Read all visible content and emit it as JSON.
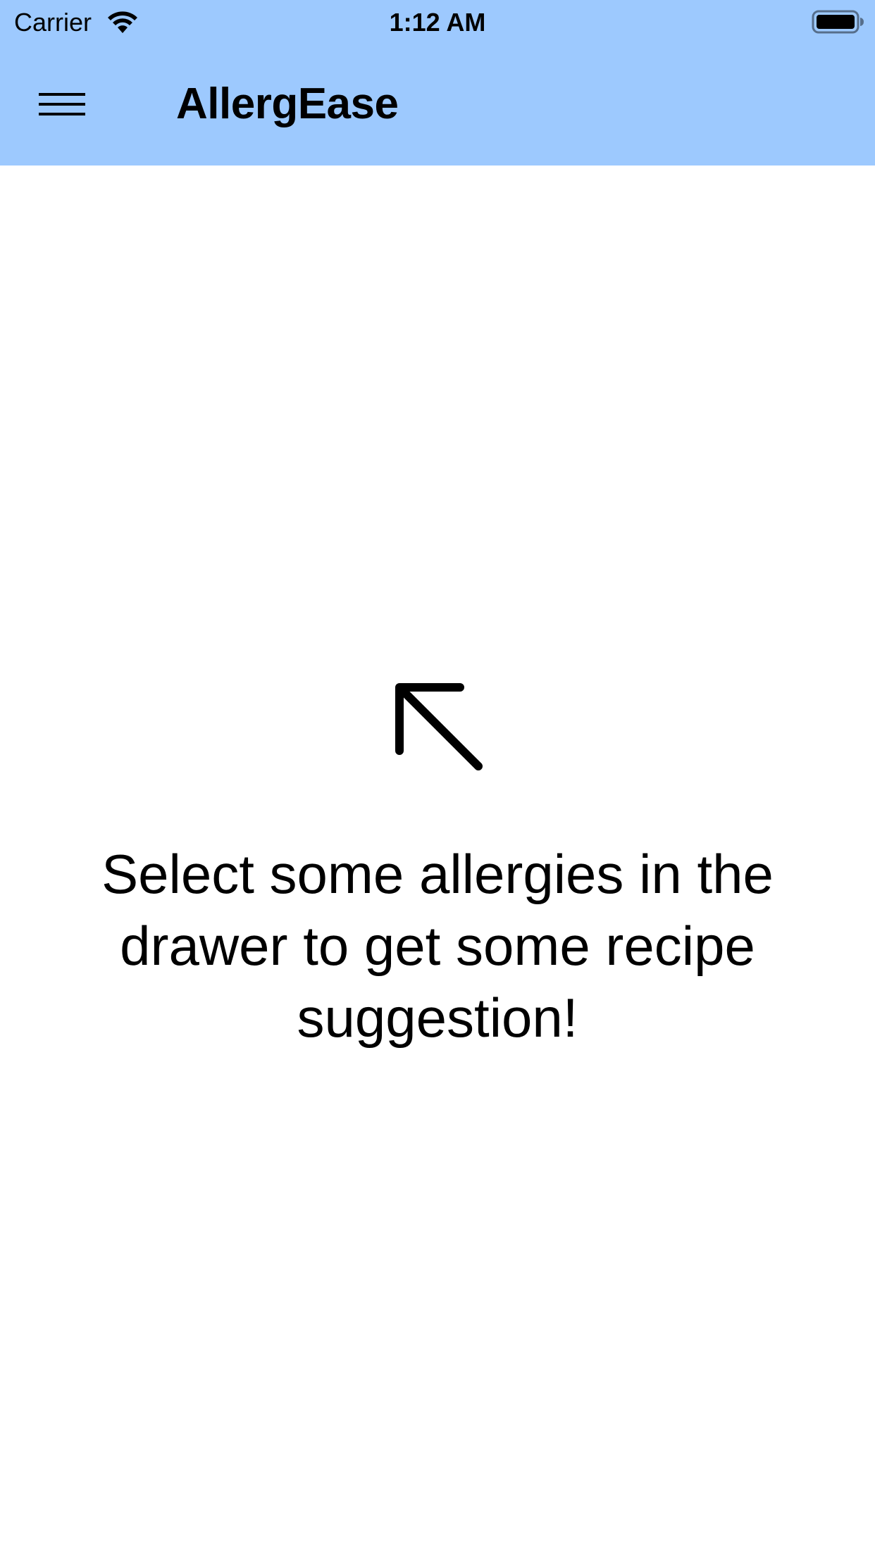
{
  "status_bar": {
    "carrier": "Carrier",
    "time": "1:12 AM",
    "icons": [
      "wifi-icon",
      "battery-icon"
    ]
  },
  "app_bar": {
    "title": "AllergEase",
    "menu_icon": "hamburger-menu-icon",
    "background_color": "#9dc9fe"
  },
  "empty_state": {
    "icon": "arrow-up-left-icon",
    "message": "Select some allergies in the drawer to get some recipe suggestion!"
  }
}
